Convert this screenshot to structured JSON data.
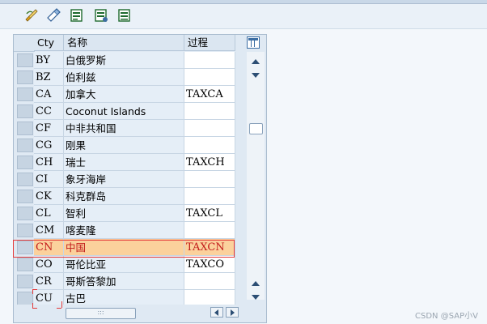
{
  "toolbar": {
    "buttons": [
      {
        "name": "edit-icon"
      },
      {
        "name": "display-change-icon"
      },
      {
        "name": "new-entries-icon"
      },
      {
        "name": "copy-as-icon"
      },
      {
        "name": "delete-icon"
      }
    ]
  },
  "table": {
    "columns": {
      "code": "Cty",
      "name": "名称",
      "procedure": "过程"
    },
    "rows": [
      {
        "code": "BY",
        "name": "白俄罗斯",
        "procedure": ""
      },
      {
        "code": "BZ",
        "name": "伯利兹",
        "procedure": ""
      },
      {
        "code": "CA",
        "name": "加拿大",
        "procedure": "TAXCA"
      },
      {
        "code": "CC",
        "name": "Coconut Islands",
        "procedure": ""
      },
      {
        "code": "CF",
        "name": "中非共和国",
        "procedure": ""
      },
      {
        "code": "CG",
        "name": "刚果",
        "procedure": ""
      },
      {
        "code": "CH",
        "name": "瑞士",
        "procedure": "TAXCH"
      },
      {
        "code": "CI",
        "name": "象牙海岸",
        "procedure": ""
      },
      {
        "code": "CK",
        "name": "科克群岛",
        "procedure": ""
      },
      {
        "code": "CL",
        "name": "智利",
        "procedure": "TAXCL"
      },
      {
        "code": "CM",
        "name": "喀麦隆",
        "procedure": ""
      },
      {
        "code": "CN",
        "name": "中国",
        "procedure": "TAXCN",
        "highlighted": true
      },
      {
        "code": "CO",
        "name": "哥伦比亚",
        "procedure": "TAXCO"
      },
      {
        "code": "CR",
        "name": "哥斯答黎加",
        "procedure": ""
      },
      {
        "code": "CU",
        "name": "古巴",
        "procedure": ""
      }
    ]
  },
  "colors": {
    "highlight_fill": "#fbd19c",
    "highlight_text": "#c21a1a",
    "highlight_border": "#e53a3a"
  },
  "watermark": "CSDN @SAP小V"
}
